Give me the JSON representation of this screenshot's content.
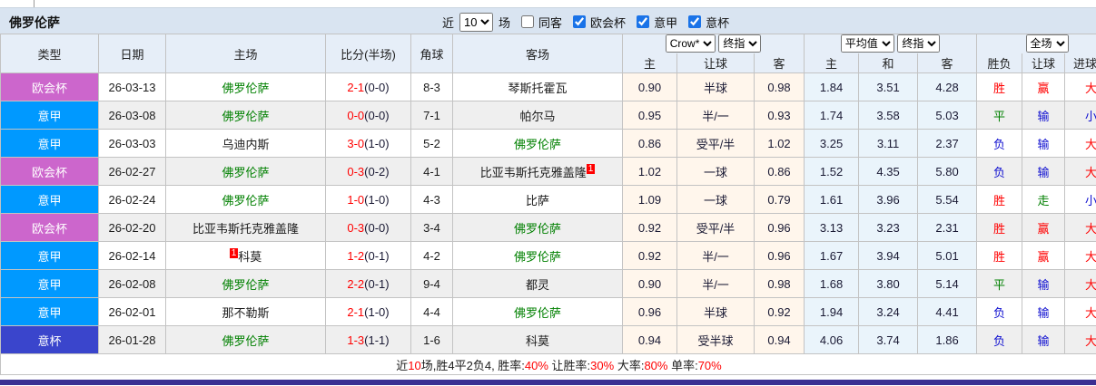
{
  "title": "佛罗伦萨",
  "toolbar": {
    "recent_label": "近",
    "recent_value": "10",
    "matches_label": "场",
    "same_away_label": "同客",
    "same_away_checked": false,
    "filters": [
      {
        "label": "欧会杯",
        "checked": true
      },
      {
        "label": "意甲",
        "checked": true
      },
      {
        "label": "意杯",
        "checked": true
      }
    ]
  },
  "header": {
    "columns": [
      "类型",
      "日期",
      "主场",
      "比分(半场)",
      "角球",
      "客场"
    ],
    "selects": {
      "asia": [
        "Crow*",
        "终指"
      ],
      "europe": [
        "平均值",
        "终指"
      ],
      "result": [
        "全场"
      ]
    },
    "sub_columns": [
      "主",
      "让球",
      "客",
      "主",
      "和",
      "客",
      "胜负",
      "让球",
      "进球数"
    ]
  },
  "highlight_team": "佛罗伦萨",
  "rows": [
    {
      "type": "欧会杯",
      "date": "26-03-13",
      "home": "佛罗伦萨",
      "score_ft": "2-1",
      "score_ht": "(0-0)",
      "corners": "8-3",
      "away": "琴斯托霍瓦",
      "asia": [
        "0.90",
        "半球",
        "0.98"
      ],
      "europe": [
        "1.84",
        "3.51",
        "4.28"
      ],
      "results": [
        "胜",
        "赢",
        "大"
      ]
    },
    {
      "type": "意甲",
      "date": "26-03-08",
      "home": "佛罗伦萨",
      "score_ft": "0-0",
      "score_ht": "(0-0)",
      "corners": "7-1",
      "away": "帕尔马",
      "asia": [
        "0.95",
        "半/一",
        "0.93"
      ],
      "europe": [
        "1.74",
        "3.58",
        "5.03"
      ],
      "results": [
        "平",
        "输",
        "小"
      ]
    },
    {
      "type": "意甲",
      "date": "26-03-03",
      "home": "乌迪内斯",
      "score_ft": "3-0",
      "score_ht": "(1-0)",
      "corners": "5-2",
      "away": "佛罗伦萨",
      "asia": [
        "0.86",
        "受平/半",
        "1.02"
      ],
      "europe": [
        "3.25",
        "3.11",
        "2.37"
      ],
      "results": [
        "负",
        "输",
        "大"
      ]
    },
    {
      "type": "欧会杯",
      "date": "26-02-27",
      "home": "佛罗伦萨",
      "score_ft": "0-3",
      "score_ht": "(0-2)",
      "corners": "4-1",
      "away": "比亚韦斯托克雅盖隆",
      "away_badge": {
        "text": "1",
        "side": "after"
      },
      "asia": [
        "1.02",
        "一球",
        "0.86"
      ],
      "europe": [
        "1.52",
        "4.35",
        "5.80"
      ],
      "results": [
        "负",
        "输",
        "大"
      ]
    },
    {
      "type": "意甲",
      "date": "26-02-24",
      "home": "佛罗伦萨",
      "score_ft": "1-0",
      "score_ht": "(1-0)",
      "corners": "4-3",
      "away": "比萨",
      "asia": [
        "1.09",
        "一球",
        "0.79"
      ],
      "europe": [
        "1.61",
        "3.96",
        "5.54"
      ],
      "results": [
        "胜",
        "走",
        "小"
      ]
    },
    {
      "type": "欧会杯",
      "date": "26-02-20",
      "home": "比亚韦斯托克雅盖隆",
      "score_ft": "0-3",
      "score_ht": "(0-0)",
      "corners": "3-4",
      "away": "佛罗伦萨",
      "asia": [
        "0.92",
        "受平/半",
        "0.96"
      ],
      "europe": [
        "3.13",
        "3.23",
        "2.31"
      ],
      "results": [
        "胜",
        "赢",
        "大"
      ]
    },
    {
      "type": "意甲",
      "date": "26-02-14",
      "home": "科莫",
      "home_badge": {
        "text": "1",
        "side": "before"
      },
      "score_ft": "1-2",
      "score_ht": "(0-1)",
      "corners": "4-2",
      "away": "佛罗伦萨",
      "asia": [
        "0.92",
        "半/一",
        "0.96"
      ],
      "europe": [
        "1.67",
        "3.94",
        "5.01"
      ],
      "results": [
        "胜",
        "赢",
        "大"
      ]
    },
    {
      "type": "意甲",
      "date": "26-02-08",
      "home": "佛罗伦萨",
      "score_ft": "2-2",
      "score_ht": "(0-1)",
      "corners": "9-4",
      "away": "都灵",
      "asia": [
        "0.90",
        "半/一",
        "0.98"
      ],
      "europe": [
        "1.68",
        "3.80",
        "5.14"
      ],
      "results": [
        "平",
        "输",
        "大"
      ]
    },
    {
      "type": "意甲",
      "date": "26-02-01",
      "home": "那不勒斯",
      "score_ft": "2-1",
      "score_ht": "(1-0)",
      "corners": "4-4",
      "away": "佛罗伦萨",
      "asia": [
        "0.96",
        "半球",
        "0.92"
      ],
      "europe": [
        "1.94",
        "3.24",
        "4.41"
      ],
      "results": [
        "负",
        "输",
        "大"
      ]
    },
    {
      "type": "意杯",
      "date": "26-01-28",
      "home": "佛罗伦萨",
      "score_ft": "1-3",
      "score_ht": "(1-1)",
      "corners": "1-6",
      "away": "科莫",
      "asia": [
        "0.94",
        "受半球",
        "0.94"
      ],
      "europe": [
        "4.06",
        "3.74",
        "1.86"
      ],
      "results": [
        "负",
        "输",
        "大"
      ]
    }
  ],
  "summary_parts": [
    {
      "t": "近"
    },
    {
      "t": "10",
      "red": true
    },
    {
      "t": "场,胜4平2负4, 胜率:"
    },
    {
      "t": "40%",
      "red": true
    },
    {
      "t": " 让胜率:"
    },
    {
      "t": "30%",
      "red": true
    },
    {
      "t": " 大率:"
    },
    {
      "t": "80%",
      "red": true
    },
    {
      "t": " 单率:"
    },
    {
      "t": "70%",
      "red": true
    }
  ],
  "colors": {
    "red": "#ff0000",
    "green": "#008000",
    "blue": "#0f0fd0",
    "navy": "#191933",
    "leagues": {
      "欧会杯": "#cc66cc",
      "意甲": "#0099ff",
      "意杯": "#3a45cc"
    },
    "title_bar_bg": "#d9e4f1",
    "header_bg": "#e6eef8",
    "alt_row_bg": "#efefef",
    "asia_col_bg": "#fff6ec",
    "euro_col_bg": "#eaf4fb",
    "bottom_bar": "#3b2f92"
  }
}
